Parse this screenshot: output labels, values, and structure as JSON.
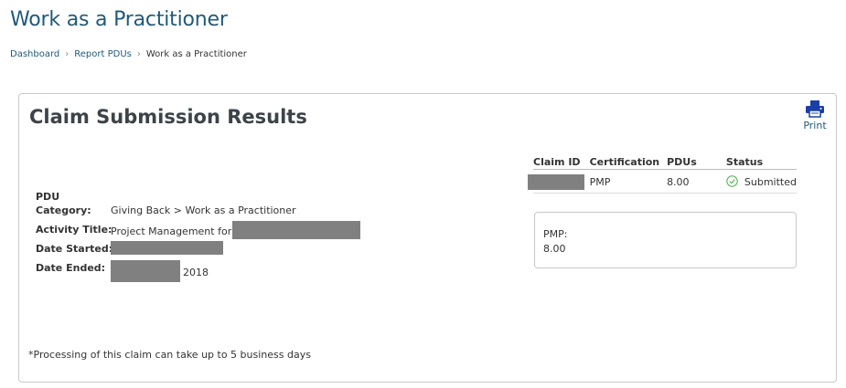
{
  "page": {
    "title": "Work as a Practitioner"
  },
  "breadcrumb": {
    "items": [
      "Dashboard",
      "Report PDUs",
      "Work as a Practitioner"
    ],
    "separator": ">"
  },
  "card": {
    "title": "Claim Submission Results",
    "print_label": "Print",
    "print_icon": "printer-icon",
    "accent_color": "#1f5a7a",
    "icon_color": "#1b3fa8"
  },
  "details": {
    "pdu_label": "PDU",
    "category_label": "Category:",
    "category_value": "Giving Back > Work as a Practitioner",
    "activity_title_label": "Activity Title:",
    "activity_title_value": "Project Management for",
    "date_started_label": "Date Started:",
    "date_ended_label": "Date Ended:",
    "date_ended_year": "2018"
  },
  "claims_table": {
    "headers": [
      "Claim ID",
      "Certification",
      "PDUs",
      "Status"
    ],
    "rows": [
      {
        "certification": "PMP",
        "pdus": "8.00",
        "status": "Submitted",
        "status_icon": "check-circle-icon"
      }
    ]
  },
  "summary": {
    "certification": "PMP:",
    "pdus": "8.00"
  },
  "footnote": "*Processing of this claim can take up to 5 business days"
}
